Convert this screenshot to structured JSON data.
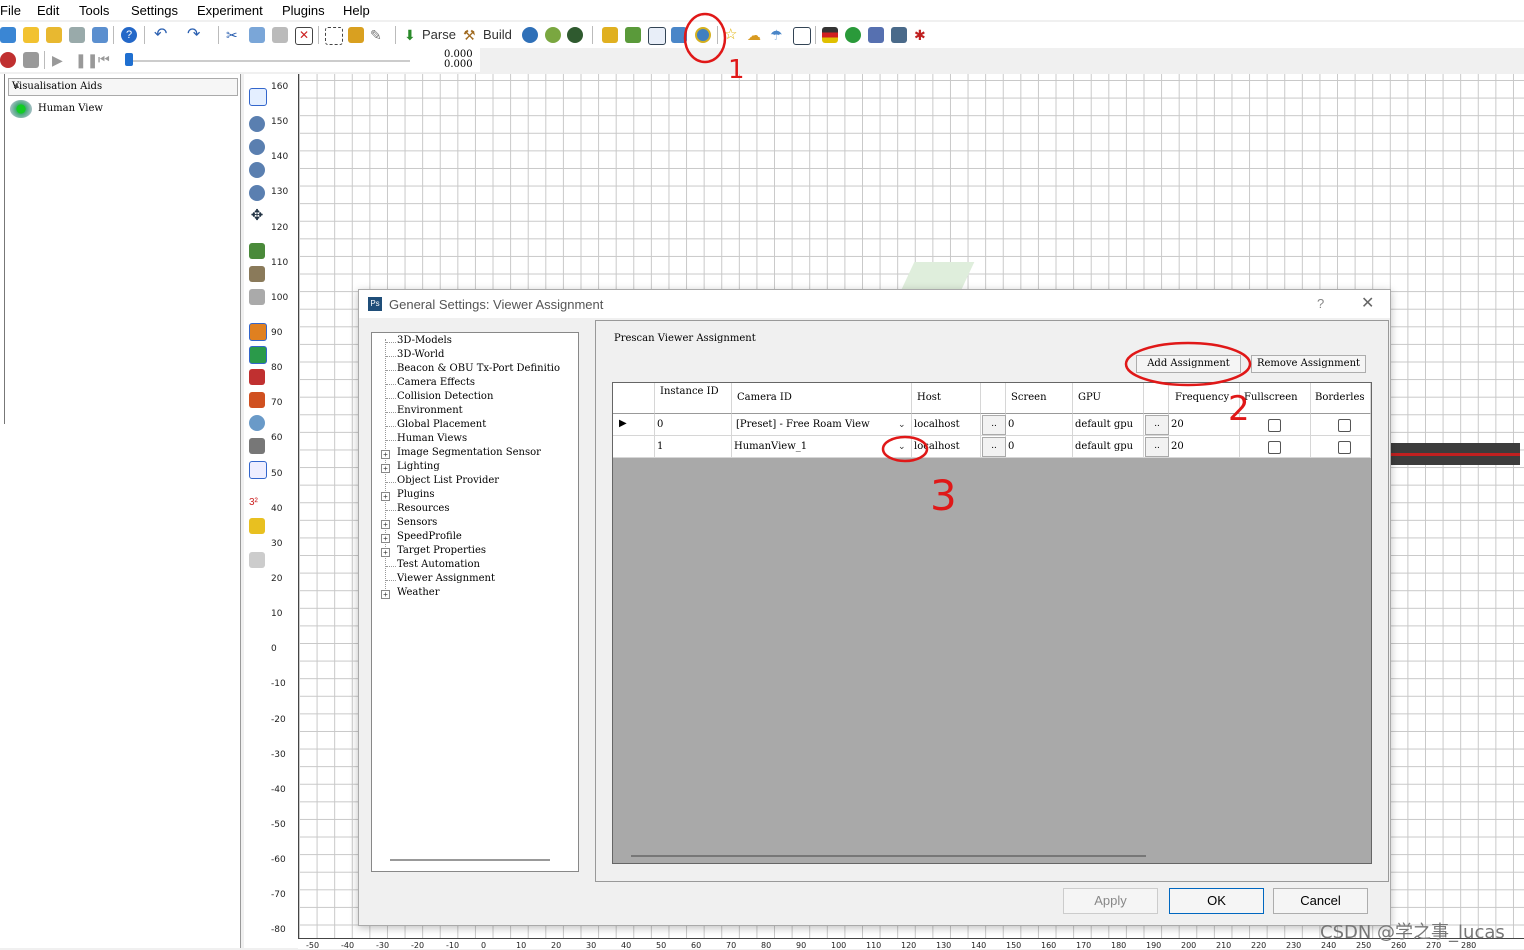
{
  "menu": [
    "File",
    "Edit",
    "Tools",
    "Settings",
    "Experiment",
    "Plugins",
    "Help"
  ],
  "toolbar": {
    "parse_label": "Parse",
    "build_label": "Build",
    "time_top": "0.000",
    "time_bottom": "0.000"
  },
  "left_panel": {
    "header": "Visualisation Aids",
    "item": "Human View"
  },
  "ruler": {
    "vertical": [
      "160",
      "150",
      "140",
      "130",
      "120",
      "110",
      "100",
      "90",
      "80",
      "70",
      "60",
      "50",
      "40",
      "30",
      "20",
      "10",
      "0",
      "-10",
      "-20",
      "-30",
      "-40",
      "-50",
      "-60",
      "-70",
      "-80"
    ],
    "horizontal": [
      "-50",
      "-40",
      "-30",
      "-20",
      "-10",
      "0",
      "10",
      "20",
      "30",
      "40",
      "50",
      "60",
      "70",
      "80",
      "90",
      "100",
      "110",
      "120",
      "130",
      "140",
      "150",
      "160",
      "170",
      "180",
      "190",
      "200",
      "210",
      "220",
      "230",
      "240",
      "250",
      "260",
      "270",
      "280"
    ]
  },
  "dialog": {
    "title": "General Settings: Viewer Assignment",
    "help": "?",
    "close": "✕",
    "tree": [
      {
        "label": "3D-Models",
        "expandable": false
      },
      {
        "label": "3D-World",
        "expandable": false
      },
      {
        "label": "Beacon & OBU Tx-Port Definitio",
        "expandable": false
      },
      {
        "label": "Camera Effects",
        "expandable": false
      },
      {
        "label": "Collision Detection",
        "expandable": false
      },
      {
        "label": "Environment",
        "expandable": false
      },
      {
        "label": "Global Placement",
        "expandable": false
      },
      {
        "label": "Human Views",
        "expandable": false
      },
      {
        "label": "Image Segmentation Sensor",
        "expandable": true
      },
      {
        "label": "Lighting",
        "expandable": true
      },
      {
        "label": "Object List Provider",
        "expandable": false
      },
      {
        "label": "Plugins",
        "expandable": true
      },
      {
        "label": "Resources",
        "expandable": false
      },
      {
        "label": "Sensors",
        "expandable": true
      },
      {
        "label": "SpeedProfile",
        "expandable": true
      },
      {
        "label": "Target Properties",
        "expandable": true
      },
      {
        "label": "Test Automation",
        "expandable": false
      },
      {
        "label": "Viewer Assignment",
        "expandable": false
      },
      {
        "label": "Weather",
        "expandable": true
      }
    ],
    "section_title": "Prescan Viewer Assignment",
    "add_button": "Add Assignment",
    "remove_button": "Remove Assignment",
    "columns": [
      "Instance ID",
      "Camera ID",
      "Host",
      "Screen",
      "GPU",
      "Frequency",
      "Fullscreen",
      "Borderles"
    ],
    "rows": [
      {
        "instance": "0",
        "camera": "[Preset] - Free Roam View",
        "host": "localhost",
        "screen": "0",
        "gpu": "default gpu",
        "frequency": "20",
        "fullscreen": false,
        "borderless": false
      },
      {
        "instance": "1",
        "camera": "HumanView_1",
        "host": "localhost",
        "screen": "0",
        "gpu": "default gpu",
        "frequency": "20",
        "fullscreen": false,
        "borderless": false
      }
    ],
    "ellipsis": "..",
    "apply": "Apply",
    "ok": "OK",
    "cancel": "Cancel"
  },
  "annotations": [
    "1",
    "2",
    "3"
  ],
  "watermark": "CSDN @学之事_lucas"
}
